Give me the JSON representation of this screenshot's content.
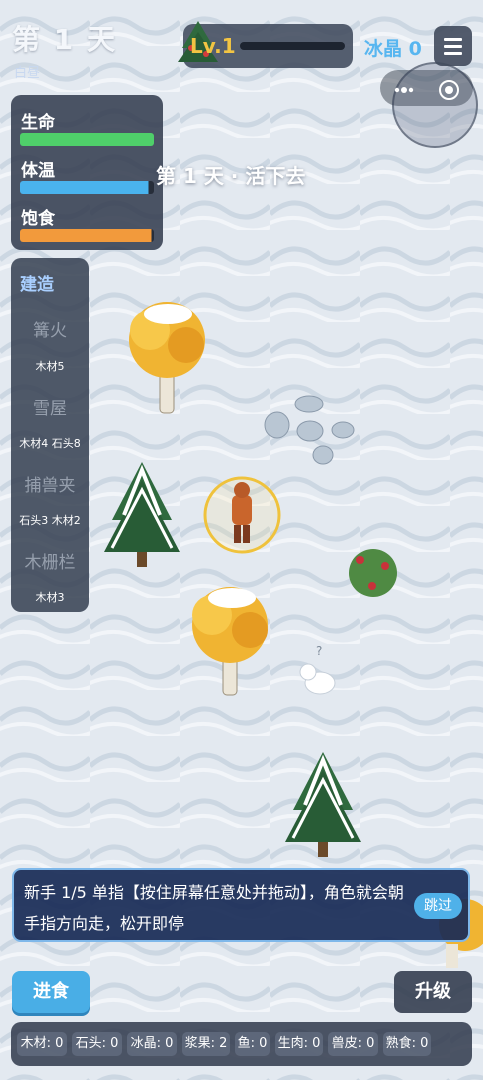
{
  "hud": {
    "day_title": "第 1 天",
    "day_sub": "白昼",
    "level_label": "Lv.1",
    "xp_fraction": 0.0,
    "crystal_label": "冰晶 0",
    "menu_icon": "hamburger-menu-icon",
    "capsule_more_icon": "more-dots-icon",
    "capsule_record_icon": "record-icon"
  },
  "stats": {
    "items": [
      {
        "label": "生命",
        "level": 1.0,
        "color": "#4fcf6a"
      },
      {
        "label": "体温",
        "level": 0.96,
        "color": "#4ab3ee"
      },
      {
        "label": "饱食",
        "level": 0.98,
        "color": "#f29a3c"
      }
    ]
  },
  "center_message": "第 1 天 · 活下去",
  "build": {
    "title": "建造",
    "items": [
      {
        "name": "篝火",
        "cost": "木材5"
      },
      {
        "name": "雪屋",
        "cost": "木材4 石头8"
      },
      {
        "name": "捕兽夹",
        "cost": "石头3 木材2"
      },
      {
        "name": "木栅栏",
        "cost": "木材3"
      }
    ]
  },
  "tutorial": {
    "text": "新手 1/5 单指【按住屏幕任意处并拖动】，角色就会朝手指方向走，松开即停",
    "skip_label": "跳过"
  },
  "buttons": {
    "eat": "进食",
    "upgrade": "升级"
  },
  "inventory": [
    "木材: 0",
    "石头: 0",
    "冰晶: 0",
    "浆果: 2",
    "鱼: 0",
    "生肉: 0",
    "兽皮: 0",
    "熟食: 0"
  ],
  "colors": {
    "snow": "#dfe6ee",
    "panel": "#343e50",
    "accent": "#49aee6",
    "gold": "#f2c443"
  }
}
